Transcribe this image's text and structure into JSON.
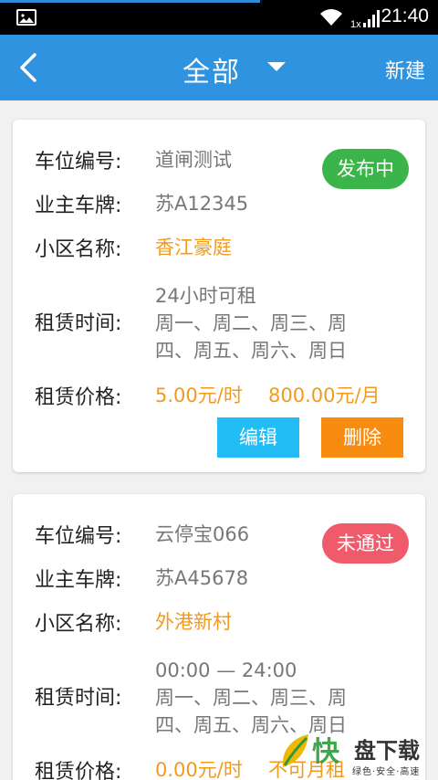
{
  "status_bar": {
    "time": "21:40",
    "network": "1x"
  },
  "app_bar": {
    "title": "全部",
    "new_label": "新建"
  },
  "labels": {
    "spot_no": "车位编号:",
    "plate": "业主车牌:",
    "community": "小区名称:",
    "rent_time": "租赁时间:",
    "rent_price": "租赁价格:"
  },
  "listings": [
    {
      "spot_no": "道闸测试",
      "plate": "苏A12345",
      "community": "香江豪庭",
      "time_line1": "24小时可租",
      "time_line2": "周一、周二、周三、周",
      "time_line3": "四、周五、周六、周日",
      "price_hour": "5.00元/时",
      "price_month": "800.00元/月",
      "status": "发布中",
      "edit_label": "编辑",
      "delete_label": "删除"
    },
    {
      "spot_no": "云停宝066",
      "plate": "苏A45678",
      "community": "外港新村",
      "time_line1": "00:00 — 24:00",
      "time_line2": "周一、周二、周三、周",
      "time_line3": "四、周五、周六、周日",
      "price_hour": "0.00元/时",
      "price_month": "不可月租",
      "status": "未通过"
    }
  ],
  "watermark": {
    "brand_char": "快",
    "brand_text": "盘下载",
    "slogan": "绿色·安全·高速"
  },
  "colors": {
    "appbar": "#2f93e0",
    "green_badge": "#3bb54a",
    "red_badge": "#f05b6b",
    "edit": "#22bdf5",
    "delete": "#f88c11",
    "orange_text": "#f29a1e"
  }
}
